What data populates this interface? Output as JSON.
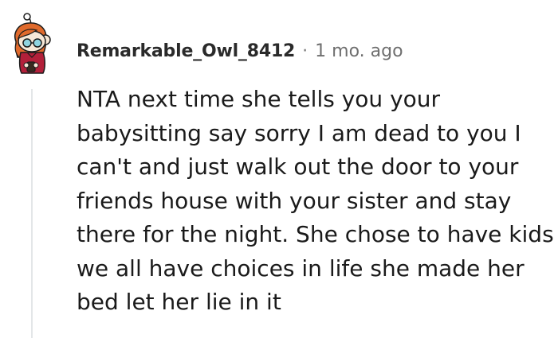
{
  "comment": {
    "username": "Remarkable_Owl_8412",
    "separator": "·",
    "timestamp": "1 mo. ago",
    "body_lines": [
      "NTA next time she tells you your",
      "babysitting say sorry I am dead to you I",
      "can't and just walk out the door to your",
      "friends house with your sister and stay",
      "there for the night. She chose to have kids",
      "we all have choices in life she made her",
      "bed let her lie in it"
    ]
  },
  "colors": {
    "username": "#2a2a2a",
    "timestamp": "#6f6f6f",
    "body": "#1a1a1a",
    "thread_line": "#e3e6e8",
    "avatar_hair": "#e06a2c",
    "avatar_shirt": "#b3203a",
    "avatar_skin": "#f7e8d7"
  },
  "icons": {
    "avatar": "snoo-avatar-icon"
  }
}
